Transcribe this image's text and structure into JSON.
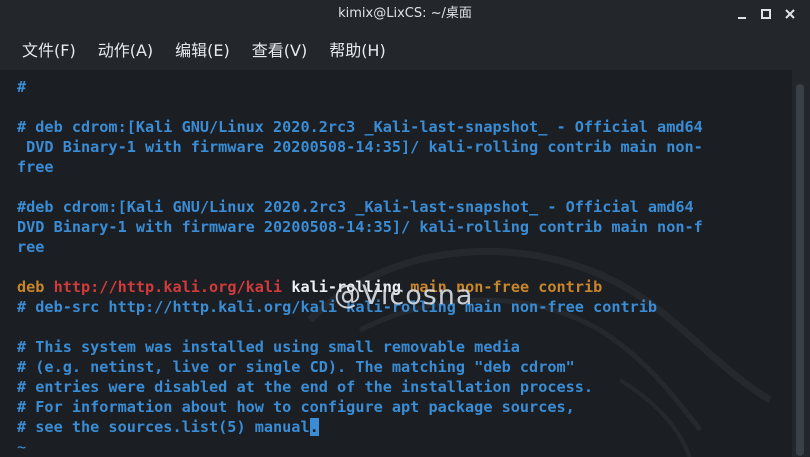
{
  "window": {
    "title": "kimix@LixCS: ~/桌面",
    "minimize_icon": "minimize-icon",
    "maximize_icon": "maximize-icon",
    "close_icon": "close-icon"
  },
  "menubar": {
    "items": [
      "文件(F)",
      "动作(A)",
      "编辑(E)",
      "查看(V)",
      "帮助(H)"
    ]
  },
  "terminal": {
    "lines": [
      "#",
      "# deb cdrom:[Kali GNU/Linux 2020.2rc3 _Kali-last-snapshot_ - Official amd64",
      " DVD Binary-1 with firmware 20200508-14:35]/ kali-rolling contrib main non-",
      "free",
      "#deb cdrom:[Kali GNU/Linux 2020.2rc3 _Kali-last-snapshot_ - Official amd64",
      "DVD Binary-1 with firmware 20200508-14:35]/ kali-rolling contrib main non-f",
      "ree",
      "# deb-src http://http.kali.org/kali kali-rolling main non-free contrib",
      "# This system was installed using small removable media",
      "# (e.g. netinst, live or single CD). The matching \"deb cdrom\"",
      "# entries were disabled at the end of the installation process.",
      "# For information about how to configure apt package sources,",
      "~"
    ],
    "deb_line": {
      "keyword": "deb",
      "url": "http://http.kali.org/kali",
      "suite": "kali-rolling",
      "components": "main non-free contrib"
    },
    "last_line": {
      "text": "# see the sources.list(5) manual",
      "cursor_char": "."
    }
  },
  "watermark": "@Vicosna",
  "colors": {
    "background": "#1b1e23",
    "chrome": "#23262b",
    "comment_blue": "#3a8cd4",
    "keyword_orange": "#c8852a",
    "url_red": "#d23b3b",
    "text_white": "#eef2f6"
  }
}
